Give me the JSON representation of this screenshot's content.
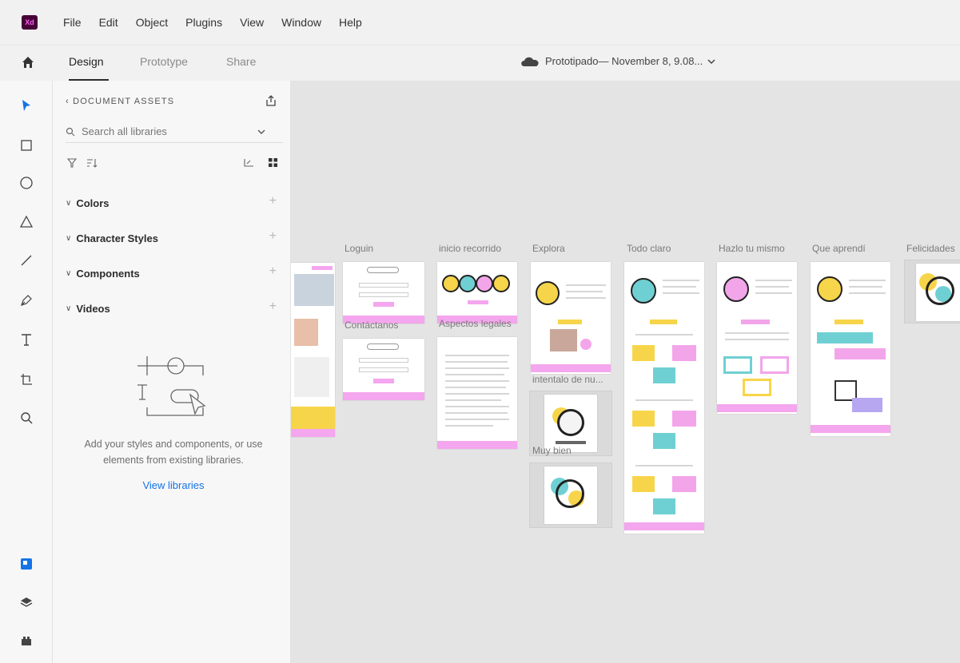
{
  "menubar": {
    "logo": "Xd",
    "items": [
      "File",
      "Edit",
      "Object",
      "Plugins",
      "View",
      "Window",
      "Help"
    ]
  },
  "tabs": {
    "design": "Design",
    "prototype": "Prototype",
    "share": "Share"
  },
  "document": {
    "title": "Prototipado— November 8, 9.08...",
    "icon": "cloud-icon"
  },
  "assets_panel": {
    "header": "DOCUMENT ASSETS",
    "search_placeholder": "Search all libraries",
    "sections": [
      "Colors",
      "Character Styles",
      "Components",
      "Videos"
    ],
    "empty_text": "Add your styles and components, or use elements from existing libraries.",
    "view_libraries": "View libraries"
  },
  "tools": [
    "select-icon",
    "rectangle-icon",
    "ellipse-icon",
    "polygon-icon",
    "line-icon",
    "pen-icon",
    "text-icon",
    "artboard-icon",
    "zoom-icon"
  ],
  "bottom_tools": [
    "assets-icon",
    "layers-icon",
    "plugins-icon"
  ],
  "artboards": {
    "loguin": "Loguin",
    "inicio": "inicio recorrido",
    "explora": "Explora",
    "todo_claro": "Todo claro",
    "hazlo": "Hazlo tu mismo",
    "que_aprendi": "Que aprendí",
    "felicidades": "Felicidades",
    "contactanos": "Contáctanos",
    "aspectos": "Aspectos legales",
    "intentalo": "intentalo de nu...",
    "muy_bien": "Muy bien"
  },
  "colors": {
    "accent_blue": "#1473e6",
    "pink": "#f4a6ee",
    "yellow": "#f7d54a",
    "teal": "#6fd0d3",
    "xd_purple": "#470137"
  }
}
